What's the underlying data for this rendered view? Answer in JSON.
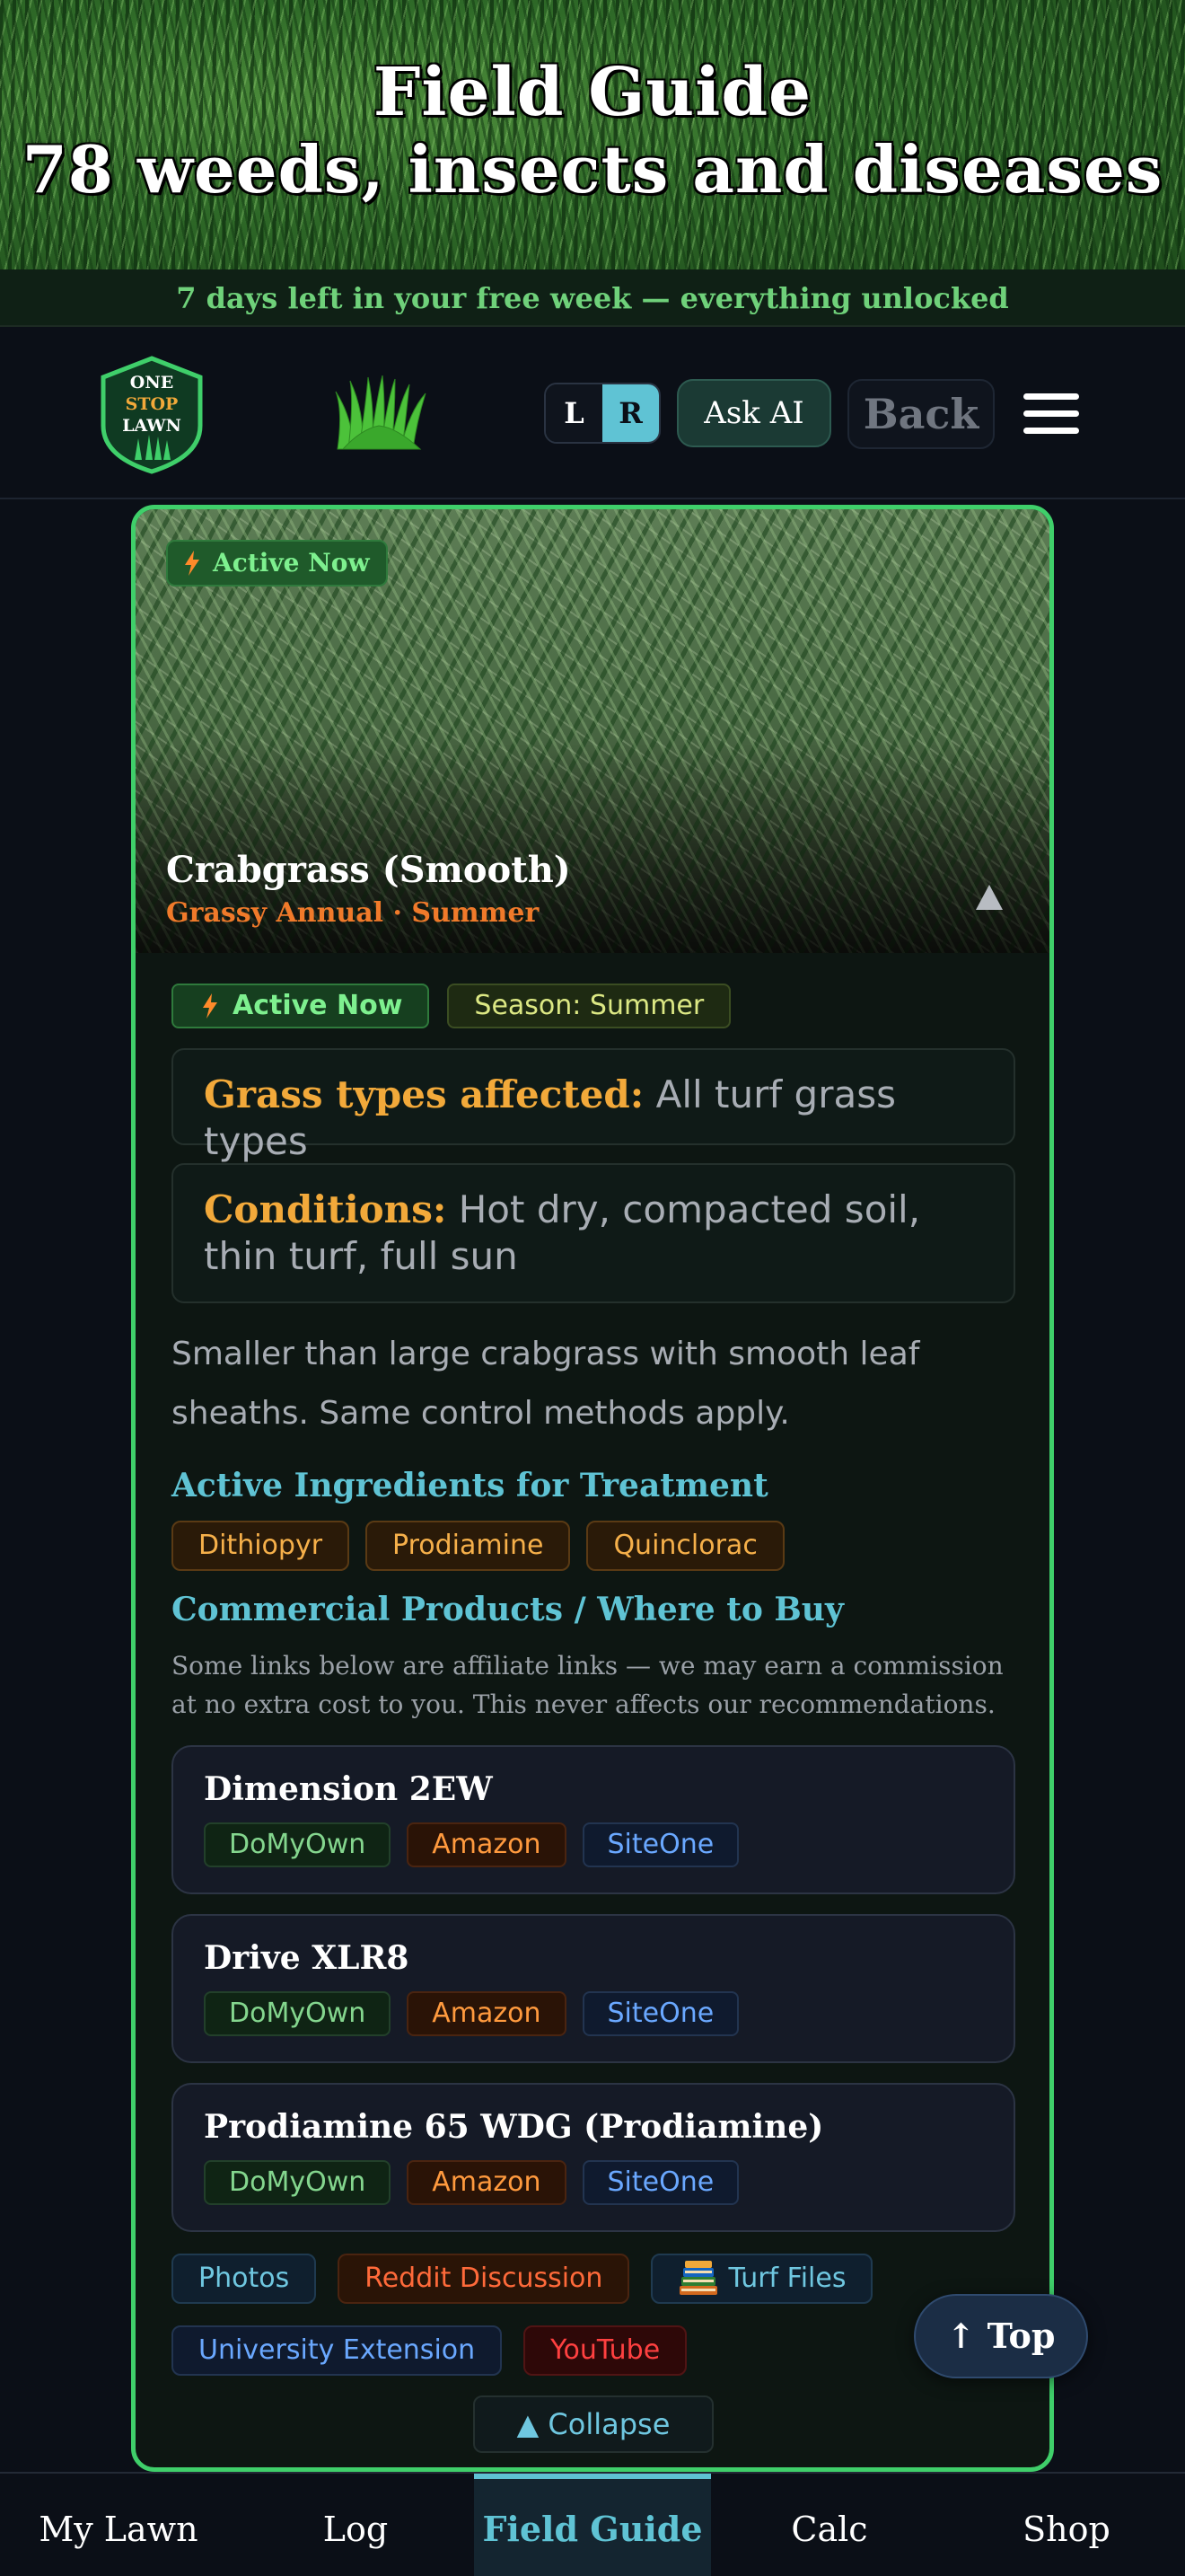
{
  "hero": {
    "title_line1": "Field Guide",
    "title_line2": "78 weeds, insects and diseases"
  },
  "trial_banner": "7 days left in your free week — everything unlocked",
  "header": {
    "logo_text": [
      "ONE",
      "STOP",
      "LAWN"
    ],
    "toggle_left": "L",
    "toggle_right": "R",
    "toggle_selected": "R",
    "ask_ai_label": "Ask AI",
    "back_label": "Back"
  },
  "card": {
    "photo_badge": "Active Now",
    "name": "Crabgrass (Smooth)",
    "subtitle": "Grassy Annual · Summer",
    "tags": {
      "active": "Active Now",
      "season": "Season: Summer"
    },
    "grass_types": {
      "label": "Grass types affected:",
      "value": "All turf grass types"
    },
    "conditions": {
      "label": "Conditions:",
      "value": "Hot dry, compacted soil, thin turf, full sun"
    },
    "description": "Smaller than large crabgrass with smooth leaf sheaths. Same control methods apply.",
    "ingredients_title": "Active Ingredients for Treatment",
    "ingredients": [
      "Dithiopyr",
      "Prodiamine",
      "Quinclorac"
    ],
    "products_title": "Commercial Products / Where to Buy",
    "affiliate_note": "Some links below are affiliate links — we may earn a commission at no extra cost to you. This never affects our recommendations.",
    "products": [
      {
        "name": "Dimension 2EW",
        "links": [
          "DoMyOwn",
          "Amazon",
          "SiteOne"
        ]
      },
      {
        "name": "Drive XLR8",
        "links": [
          "DoMyOwn",
          "Amazon",
          "SiteOne"
        ]
      },
      {
        "name": "Prodiamine 65 WDG (Prodiamine)",
        "links": [
          "DoMyOwn",
          "Amazon",
          "SiteOne"
        ]
      }
    ],
    "resources": {
      "photos": "Photos",
      "reddit": "Reddit Discussion",
      "turf_files": "Turf Files",
      "university": "University Extension",
      "youtube": "YouTube"
    },
    "collapse_label": "▲ Collapse"
  },
  "top_button": "↑ Top",
  "bottom_nav": {
    "items": [
      "My Lawn",
      "Log",
      "Field Guide",
      "Calc",
      "Shop"
    ],
    "selected": "Field Guide"
  },
  "colors": {
    "accent": "#5fc3d4",
    "active_green": "#3fcf6a",
    "warning_orange": "#f2a93a",
    "background": "#0b0f17"
  }
}
